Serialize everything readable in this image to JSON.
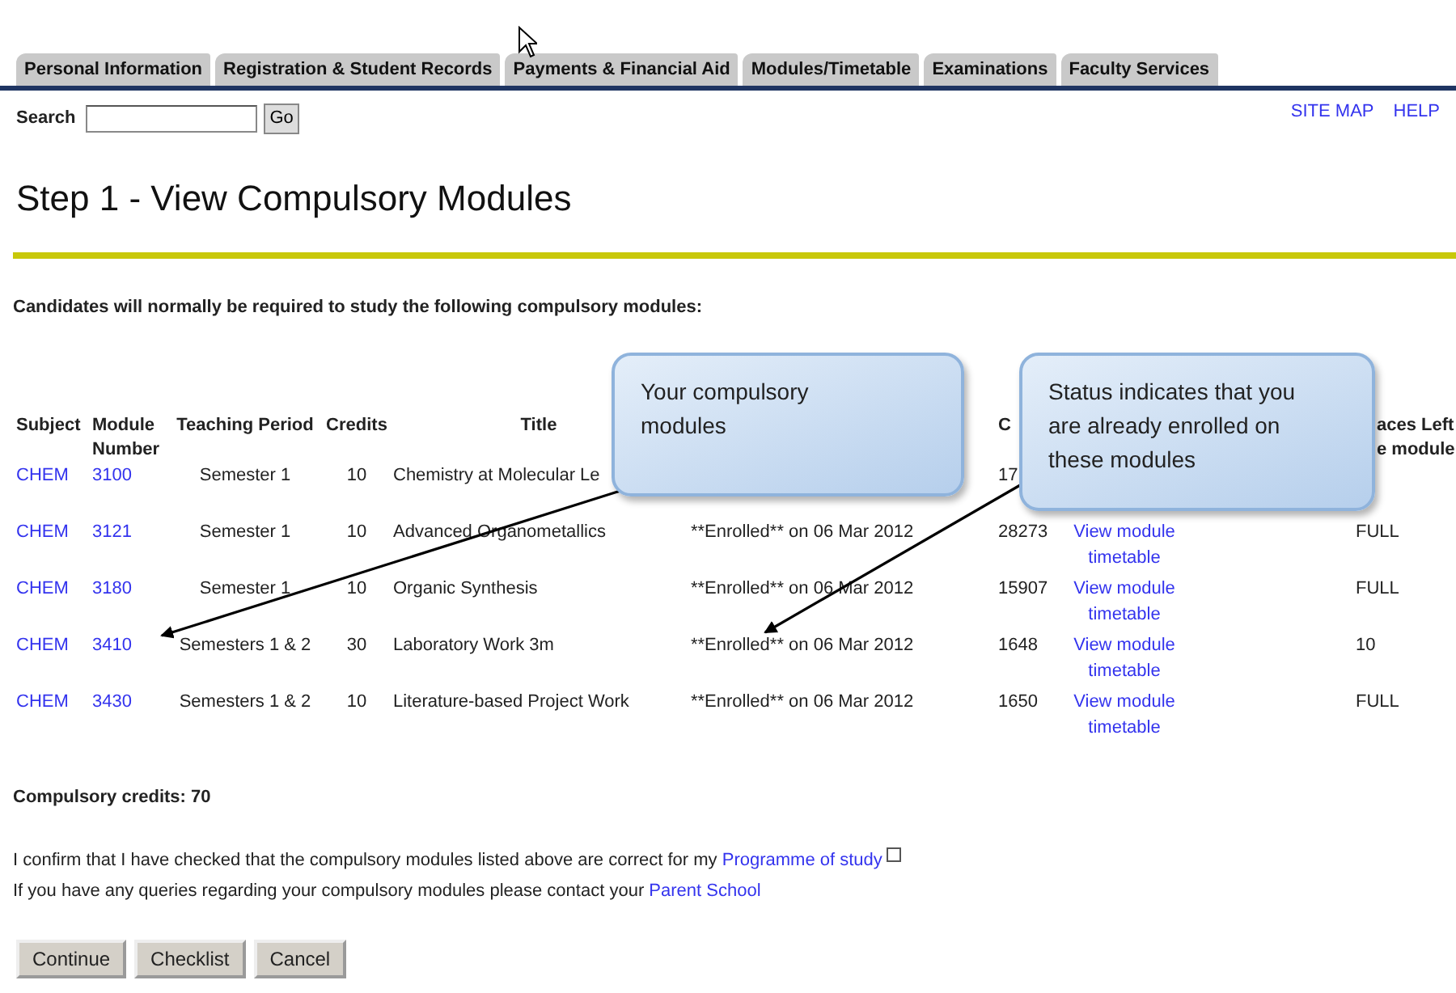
{
  "tabs": [
    {
      "label": "Personal Information"
    },
    {
      "label": "Registration & Student Records"
    },
    {
      "label": "Payments & Financial Aid"
    },
    {
      "label": "Modules/Timetable"
    },
    {
      "label": "Examinations"
    },
    {
      "label": "Faculty Services"
    }
  ],
  "search": {
    "label": "Search",
    "button": "Go"
  },
  "header_links": [
    "SITE MAP",
    "HELP"
  ],
  "page_title": "Step 1 - View Compulsory Modules",
  "intro": "Candidates will normally be required to study the following compulsory modules:",
  "table": {
    "columns": [
      "Subject",
      "Module Number",
      "Teaching Period",
      "Credits",
      "Title",
      "",
      "C",
      "",
      "",
      "aces Left\ne module"
    ],
    "rows": [
      {
        "subject": "CHEM",
        "module": "3100",
        "period": "Semester 1",
        "credits": "10",
        "title": "Chemistry at Molecular Le",
        "crn": "17"
      },
      {
        "subject": "CHEM",
        "module": "3121",
        "period": "Semester 1",
        "credits": "10",
        "title": "Advanced Organometallics",
        "status": "**Enrolled** on 06 Mar 2012",
        "crn": "28273",
        "link": "View module timetable",
        "places": "FULL"
      },
      {
        "subject": "CHEM",
        "module": "3180",
        "period": "Semester 1",
        "credits": "10",
        "title": "Organic Synthesis",
        "status": "**Enrolled** on 06 Mar 2012",
        "crn": "15907",
        "link": "View module timetable",
        "places": "FULL"
      },
      {
        "subject": "CHEM",
        "module": "3410",
        "period": "Semesters 1 & 2",
        "credits": "30",
        "title": "Laboratory Work 3m",
        "status": "**Enrolled** on 06 Mar 2012",
        "crn": "1648",
        "link": "View module timetable",
        "places": "10"
      },
      {
        "subject": "CHEM",
        "module": "3430",
        "period": "Semesters 1 & 2",
        "credits": "10",
        "title": "Literature-based Project Work",
        "status": "**Enrolled** on 06 Mar 2012",
        "crn": "1650",
        "link": "View module timetable",
        "places": "FULL"
      }
    ]
  },
  "compulsory_credits": "Compulsory credits: 70",
  "confirm": {
    "text": "I confirm that I have checked that the compulsory modules listed above are correct for my",
    "link": "Programme of study",
    "checked": false
  },
  "queries": {
    "text": "If you have any queries regarding your compulsory modules please contact your",
    "link": "Parent School"
  },
  "buttons": [
    "Continue",
    "Checklist",
    "Cancel"
  ],
  "callouts": [
    {
      "text": "Your compulsory modules"
    },
    {
      "text": "Status indicates that you are already enrolled on these modules"
    }
  ]
}
